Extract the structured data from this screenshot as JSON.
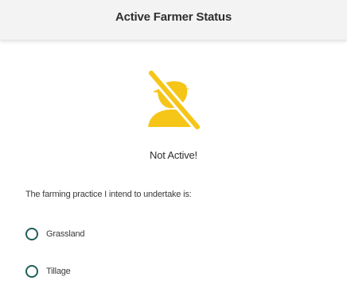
{
  "header": {
    "title": "Active Farmer Status"
  },
  "status": {
    "text": "Not Active!",
    "icon": "farmer-not-active-icon",
    "icon_color": "#f5c518"
  },
  "form": {
    "question": "The farming practice I intend to undertake is:",
    "options": [
      {
        "label": "Grassland",
        "selected": false
      },
      {
        "label": "Tillage",
        "selected": false
      }
    ]
  },
  "colors": {
    "header_bg": "#f3f3f3",
    "radio_border": "#1f5f5a",
    "text": "#2f2f2f"
  }
}
